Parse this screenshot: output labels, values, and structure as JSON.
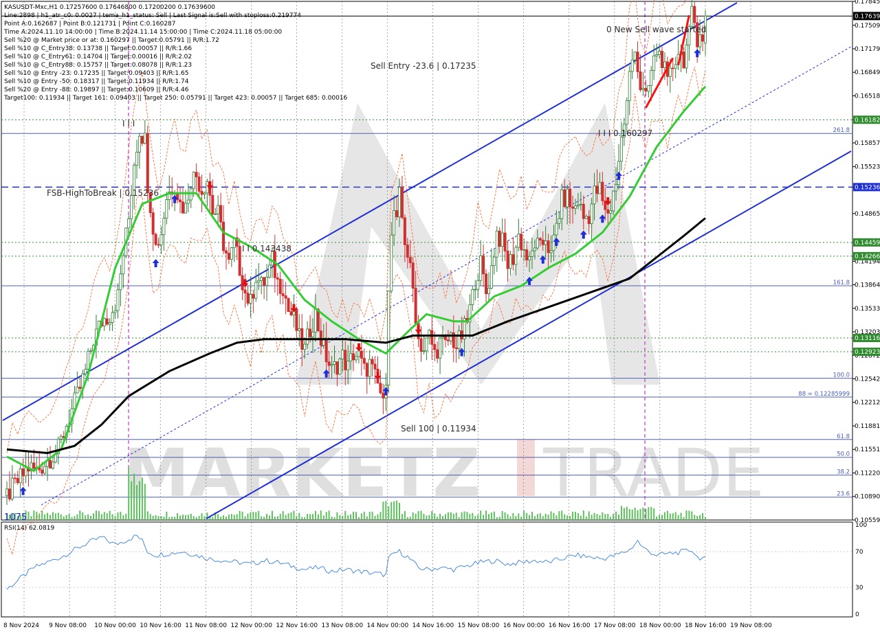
{
  "info": {
    "lines": [
      "KASUSDT-Mxc,H1  0.17257600 0.17646800 0.17200200 0.17639600",
      "Line:2898  |  h1_atr_c0: 0.0027  |  tema_h1_status: Sell  |  Last Signal is:Sell with stoploss:0.219774",
      "Point A:0.162687  |  Point B:0.121731  |  Point C:0.160287",
      "Time A:2024.11.10 14:00:00  |  Time B:2024.11.14 15:00:00  |  Time C:2024.11.18 05:00:00",
      "Sell %20 @ Market price or at: 0.160297  ||  Target:0.05791  ||  R/R:1.72",
      "Sell %10 @ C_Entry38: 0.13738  ||  Target:0.00057  ||  R/R:1.66",
      "Sell %10 @ C_Entry61: 0.14704  ||  Target:0.00016  ||  R/R:2.02",
      "Sell %10 @ C_Entry88: 0.15757  ||  Target:0.08078  ||  R/R:1.23",
      "Sell %10 @ Entry -23: 0.17235  ||  Target:0.09403  ||  R/R:1.65",
      "Sell %10 @ Entry -50: 0.18317  ||  Target:0.11934  ||  R/R:1.74",
      "Sell %20 @ Entry -88: 0.19897  ||  Target:0.10609  ||  R/R:4.46",
      "Target100: 0.11934  ||  Target 161: 0.09403  ||  Target 250: 0.05791  ||  Target 423: 0.00057  ||  Target 685: 0.00016"
    ]
  },
  "annotations": {
    "new_wave": "0 New Sell wave started",
    "sell_entry": "Sell Entry -23.6 | 0.17235",
    "point_c": "I I I 0.160297",
    "fsb": "FSB-HighToBreak | 0.15236",
    "mid_level": "I I 0.143438",
    "sell_100": "Sell 100 | 0.11934",
    "top_marks": "I I I",
    "bottom_left": "1075"
  },
  "watermark": {
    "part1": "MARKETZ",
    "part2": "TRADE"
  },
  "rsi": {
    "label": "RSI(14) 62.0819",
    "levels": [
      "100",
      "70",
      "30",
      "0"
    ]
  },
  "colors": {
    "bull": "#2e7d32",
    "bear": "#d32f2f",
    "channel": "#1f2fd6",
    "ma_green": "#33cc33",
    "ma_black": "#000000",
    "orange": "#ff5a1f",
    "fib": "#4a5fc1",
    "level_green": "#2e8b2e",
    "rsi": "#4a8be0"
  },
  "chart_data": {
    "type": "candlestick",
    "symbol": "KASUSDT-Mxc",
    "timeframe": "H1",
    "ohlc_last": {
      "open": 0.172576,
      "high": 0.176468,
      "low": 0.172002,
      "close": 0.176396
    },
    "ylim": [
      0.10559,
      0.17845
    ],
    "y_ticks": [
      "0.17845",
      "0.17509",
      "0.17179",
      "0.16849",
      "0.16518",
      "0.16182",
      "0.15857",
      "0.15523",
      "0.15236",
      "0.14865",
      "0.14459",
      "0.14266",
      "0.14194",
      "0.13864",
      "0.13533",
      "0.13203",
      "0.13116",
      "0.12923",
      "0.12872",
      "0.12542",
      "0.12212",
      "0.11881",
      "0.11551",
      "0.11220",
      "0.10890",
      "0.10559"
    ],
    "x_ticks": [
      "8 Nov 2024",
      "9 Nov 08:00",
      "10 Nov 00:00",
      "10 Nov 16:00",
      "11 Nov 08:00",
      "12 Nov 00:00",
      "12 Nov 16:00",
      "13 Nov 08:00",
      "14 Nov 00:00",
      "14 Nov 16:00",
      "15 Nov 08:00",
      "16 Nov 00:00",
      "16 Nov 16:00",
      "17 Nov 08:00",
      "18 Nov 00:00",
      "18 Nov 16:00",
      "19 Nov 08:00"
    ],
    "levels": [
      {
        "label": "0.17639",
        "value": 0.17639,
        "color": "#000000",
        "style": "solid",
        "tag": "current"
      },
      {
        "label": "0.16182",
        "value": 0.16182,
        "color": "#2e8b2e",
        "style": "dotted"
      },
      {
        "label": "261.8",
        "value": 0.1599,
        "color": "#4a5fc1",
        "style": "solid"
      },
      {
        "label": "0.15236",
        "value": 0.15236,
        "color": "#1f2fd6",
        "style": "dashed"
      },
      {
        "label": "0.14459",
        "value": 0.14459,
        "color": "#2e8b2e",
        "style": "dotted"
      },
      {
        "label": "0.14266",
        "value": 0.14266,
        "color": "#2e8b2e",
        "style": "dotted"
      },
      {
        "label": "161.8",
        "value": 0.1385,
        "color": "#4a5fc1",
        "style": "solid"
      },
      {
        "label": "0.13116",
        "value": 0.13116,
        "color": "#2e8b2e",
        "style": "dotted"
      },
      {
        "label": "0.12923",
        "value": 0.12923,
        "color": "#2e8b2e",
        "style": "dotted"
      },
      {
        "label": "100.0",
        "value": 0.1255,
        "color": "#4a5fc1",
        "style": "solid"
      },
      {
        "label": "88 = 0.12285999",
        "value": 0.12286,
        "color": "#4a5fc1",
        "style": "solid"
      },
      {
        "label": "61.8",
        "value": 0.1169,
        "color": "#4a5fc1",
        "style": "solid"
      },
      {
        "label": "50.0",
        "value": 0.1144,
        "color": "#4a5fc1",
        "style": "solid"
      },
      {
        "label": "38.2",
        "value": 0.1119,
        "color": "#4a5fc1",
        "style": "solid"
      },
      {
        "label": "23.6",
        "value": 0.1088,
        "color": "#4a5fc1",
        "style": "solid"
      }
    ],
    "price_path": [
      [
        0,
        0.109
      ],
      [
        4,
        0.111
      ],
      [
        8,
        0.113
      ],
      [
        11,
        0.1125
      ],
      [
        15,
        0.114
      ],
      [
        19,
        0.1155
      ],
      [
        22,
        0.119
      ],
      [
        26,
        0.123
      ],
      [
        29,
        0.1265
      ],
      [
        32,
        0.131
      ],
      [
        35,
        0.1335
      ],
      [
        38,
        0.1345
      ],
      [
        41,
        0.137
      ],
      [
        43,
        0.143
      ],
      [
        45,
        0.148
      ],
      [
        47,
        0.156
      ],
      [
        49,
        0.1605
      ],
      [
        51,
        0.159
      ],
      [
        52,
        0.153
      ],
      [
        54,
        0.147
      ],
      [
        55,
        0.144
      ],
      [
        57,
        0.146
      ],
      [
        59,
        0.151
      ],
      [
        62,
        0.153
      ],
      [
        64,
        0.15
      ],
      [
        66,
        0.1495
      ],
      [
        68,
        0.1535
      ],
      [
        70,
        0.154
      ],
      [
        72,
        0.152
      ],
      [
        74,
        0.1535
      ],
      [
        76,
        0.149
      ],
      [
        78,
        0.1485
      ],
      [
        80,
        0.1445
      ],
      [
        82,
        0.1415
      ],
      [
        84,
        0.1445
      ],
      [
        86,
        0.141
      ],
      [
        88,
        0.1375
      ],
      [
        90,
        0.136
      ],
      [
        92,
        0.14
      ],
      [
        94,
        0.1385
      ],
      [
        96,
        0.1395
      ],
      [
        98,
        0.142
      ],
      [
        100,
        0.139
      ],
      [
        102,
        0.1385
      ],
      [
        104,
        0.135
      ],
      [
        106,
        0.134
      ],
      [
        108,
        0.131
      ],
      [
        110,
        0.1295
      ],
      [
        112,
        0.1325
      ],
      [
        114,
        0.1345
      ],
      [
        116,
        0.131
      ],
      [
        118,
        0.1285
      ],
      [
        120,
        0.1265
      ],
      [
        122,
        0.1275
      ],
      [
        124,
        0.1285
      ],
      [
        126,
        0.127
      ],
      [
        128,
        0.129
      ],
      [
        130,
        0.1285
      ],
      [
        132,
        0.1265
      ],
      [
        134,
        0.1275
      ],
      [
        136,
        0.1255
      ],
      [
        138,
        0.1235
      ],
      [
        139,
        0.1215
      ],
      [
        140,
        0.126
      ],
      [
        141,
        0.139
      ],
      [
        142,
        0.145
      ],
      [
        143,
        0.149
      ],
      [
        144,
        0.147
      ],
      [
        145,
        0.151
      ],
      [
        147,
        0.145
      ],
      [
        148,
        0.143
      ],
      [
        150,
        0.138
      ],
      [
        152,
        0.131
      ],
      [
        154,
        0.1295
      ],
      [
        156,
        0.1315
      ],
      [
        158,
        0.129
      ],
      [
        160,
        0.1305
      ],
      [
        162,
        0.13
      ],
      [
        164,
        0.1315
      ],
      [
        166,
        0.13
      ],
      [
        168,
        0.1315
      ],
      [
        170,
        0.1335
      ],
      [
        172,
        0.137
      ],
      [
        173,
        0.1395
      ],
      [
        175,
        0.1415
      ],
      [
        177,
        0.1375
      ],
      [
        179,
        0.141
      ],
      [
        181,
        0.146
      ],
      [
        183,
        0.1445
      ],
      [
        185,
        0.1415
      ],
      [
        187,
        0.1425
      ],
      [
        189,
        0.1455
      ],
      [
        191,
        0.1435
      ],
      [
        193,
        0.1415
      ],
      [
        195,
        0.1445
      ],
      [
        197,
        0.1435
      ],
      [
        199,
        0.1455
      ],
      [
        201,
        0.1425
      ],
      [
        203,
        0.147
      ],
      [
        205,
        0.1505
      ],
      [
        207,
        0.151
      ],
      [
        209,
        0.149
      ],
      [
        211,
        0.1505
      ],
      [
        213,
        0.148
      ],
      [
        215,
        0.1485
      ],
      [
        217,
        0.1515
      ],
      [
        219,
        0.152
      ],
      [
        221,
        0.1485
      ],
      [
        223,
        0.1495
      ],
      [
        225,
        0.1535
      ],
      [
        227,
        0.159
      ],
      [
        229,
        0.164
      ],
      [
        230,
        0.168
      ],
      [
        232,
        0.1725
      ],
      [
        233,
        0.169
      ],
      [
        234,
        0.1665
      ],
      [
        236,
        0.1645
      ],
      [
        238,
        0.1685
      ],
      [
        240,
        0.1715
      ],
      [
        242,
        0.1705
      ],
      [
        244,
        0.1665
      ],
      [
        246,
        0.1695
      ],
      [
        248,
        0.1715
      ],
      [
        250,
        0.1705
      ],
      [
        252,
        0.1735
      ],
      [
        253,
        0.1765
      ],
      [
        254,
        0.1755
      ],
      [
        255,
        0.1735
      ],
      [
        256,
        0.1745
      ],
      [
        257,
        0.1725
      ],
      [
        258,
        0.1764
      ]
    ],
    "ma_green": [
      [
        0,
        0.1145
      ],
      [
        10,
        0.1125
      ],
      [
        20,
        0.1155
      ],
      [
        30,
        0.126
      ],
      [
        40,
        0.141
      ],
      [
        50,
        0.15
      ],
      [
        60,
        0.1515
      ],
      [
        70,
        0.1515
      ],
      [
        80,
        0.146
      ],
      [
        90,
        0.144
      ],
      [
        100,
        0.1415
      ],
      [
        110,
        0.1365
      ],
      [
        120,
        0.1335
      ],
      [
        130,
        0.131
      ],
      [
        140,
        0.129
      ],
      [
        148,
        0.132
      ],
      [
        155,
        0.1345
      ],
      [
        165,
        0.1335
      ],
      [
        170,
        0.1335
      ],
      [
        180,
        0.137
      ],
      [
        190,
        0.1385
      ],
      [
        200,
        0.141
      ],
      [
        210,
        0.143
      ],
      [
        220,
        0.146
      ],
      [
        230,
        0.151
      ],
      [
        240,
        0.158
      ],
      [
        250,
        0.163
      ],
      [
        258,
        0.1665
      ]
    ],
    "ma_black": [
      [
        0,
        0.1155
      ],
      [
        15,
        0.115
      ],
      [
        25,
        0.116
      ],
      [
        35,
        0.119
      ],
      [
        45,
        0.123
      ],
      [
        60,
        0.1265
      ],
      [
        75,
        0.129
      ],
      [
        85,
        0.1305
      ],
      [
        95,
        0.131
      ],
      [
        110,
        0.131
      ],
      [
        125,
        0.131
      ],
      [
        140,
        0.1305
      ],
      [
        150,
        0.1315
      ],
      [
        160,
        0.1315
      ],
      [
        172,
        0.1315
      ],
      [
        185,
        0.1335
      ],
      [
        200,
        0.1355
      ],
      [
        215,
        0.1375
      ],
      [
        230,
        0.1395
      ],
      [
        240,
        0.1425
      ],
      [
        250,
        0.1455
      ],
      [
        258,
        0.148
      ]
    ],
    "rsi_path": [
      [
        0,
        28
      ],
      [
        5,
        40
      ],
      [
        10,
        52
      ],
      [
        15,
        58
      ],
      [
        20,
        64
      ],
      [
        25,
        72
      ],
      [
        30,
        80
      ],
      [
        35,
        86
      ],
      [
        40,
        78
      ],
      [
        45,
        84
      ],
      [
        48,
        88
      ],
      [
        50,
        82
      ],
      [
        52,
        70
      ],
      [
        55,
        66
      ],
      [
        60,
        68
      ],
      [
        65,
        70
      ],
      [
        70,
        66
      ],
      [
        75,
        62
      ],
      [
        80,
        60
      ],
      [
        85,
        58
      ],
      [
        90,
        56
      ],
      [
        95,
        60
      ],
      [
        100,
        58
      ],
      [
        105,
        54
      ],
      [
        110,
        50
      ],
      [
        115,
        52
      ],
      [
        120,
        48
      ],
      [
        125,
        50
      ],
      [
        130,
        48
      ],
      [
        135,
        46
      ],
      [
        140,
        44
      ],
      [
        141,
        62
      ],
      [
        143,
        68
      ],
      [
        145,
        70
      ],
      [
        148,
        64
      ],
      [
        152,
        52
      ],
      [
        155,
        50
      ],
      [
        160,
        52
      ],
      [
        165,
        50
      ],
      [
        170,
        54
      ],
      [
        175,
        58
      ],
      [
        180,
        60
      ],
      [
        185,
        56
      ],
      [
        190,
        58
      ],
      [
        195,
        60
      ],
      [
        200,
        58
      ],
      [
        205,
        62
      ],
      [
        210,
        66
      ],
      [
        215,
        64
      ],
      [
        220,
        62
      ],
      [
        225,
        66
      ],
      [
        230,
        72
      ],
      [
        233,
        82
      ],
      [
        235,
        74
      ],
      [
        240,
        66
      ],
      [
        245,
        68
      ],
      [
        250,
        70
      ],
      [
        253,
        72
      ],
      [
        255,
        64
      ],
      [
        258,
        62
      ]
    ],
    "rsi_ylim": [
      0,
      100
    ]
  }
}
